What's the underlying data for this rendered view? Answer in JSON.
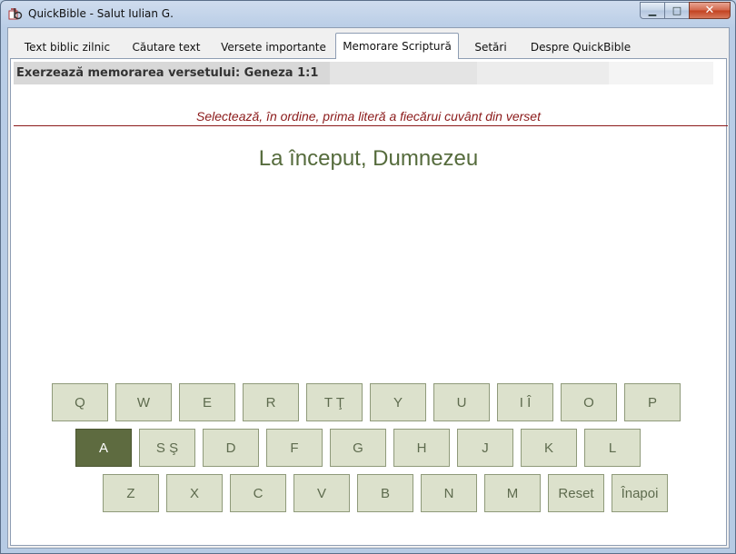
{
  "window": {
    "title": "QuickBible - Salut Iulian G.",
    "minimize_glyph": "▁",
    "maximize_glyph": "□",
    "close_glyph": "✕"
  },
  "tabs": [
    {
      "label": "Text biblic zilnic"
    },
    {
      "label": "Căutare text"
    },
    {
      "label": "Versete importante"
    },
    {
      "label": "Memorare Scriptură",
      "active": true
    },
    {
      "label": "Setări"
    },
    {
      "label": "Despre QuickBible"
    }
  ],
  "panel": {
    "header": "Exerzează memorarea versetului: Geneza 1:1",
    "instruction": "Selectează, în ordine, prima literă a fiecărui cuvânt din verset",
    "verse_progress": "La început, Dumnezeu"
  },
  "keyboard": {
    "rows": [
      [
        {
          "label": "Q"
        },
        {
          "label": "W"
        },
        {
          "label": "E"
        },
        {
          "label": "R"
        },
        {
          "label": "T Ţ"
        },
        {
          "label": "Y"
        },
        {
          "label": "U"
        },
        {
          "label": "I Î"
        },
        {
          "label": "O"
        },
        {
          "label": "P"
        }
      ],
      [
        {
          "label": "A",
          "selected": true
        },
        {
          "label": "S Ş"
        },
        {
          "label": "D"
        },
        {
          "label": "F"
        },
        {
          "label": "G"
        },
        {
          "label": "H"
        },
        {
          "label": "J"
        },
        {
          "label": "K"
        },
        {
          "label": "L"
        }
      ],
      [
        {
          "label": "Z"
        },
        {
          "label": "X"
        },
        {
          "label": "C"
        },
        {
          "label": "V"
        },
        {
          "label": "B"
        },
        {
          "label": "N"
        },
        {
          "label": "M"
        },
        {
          "label": "Reset"
        },
        {
          "label": "Înapoi"
        }
      ]
    ]
  },
  "colors": {
    "key_bg": "#dce1cc",
    "key_selected_bg": "#5e6b40",
    "instruction_color": "#8b1a1a",
    "verse_color": "#556b3c"
  }
}
